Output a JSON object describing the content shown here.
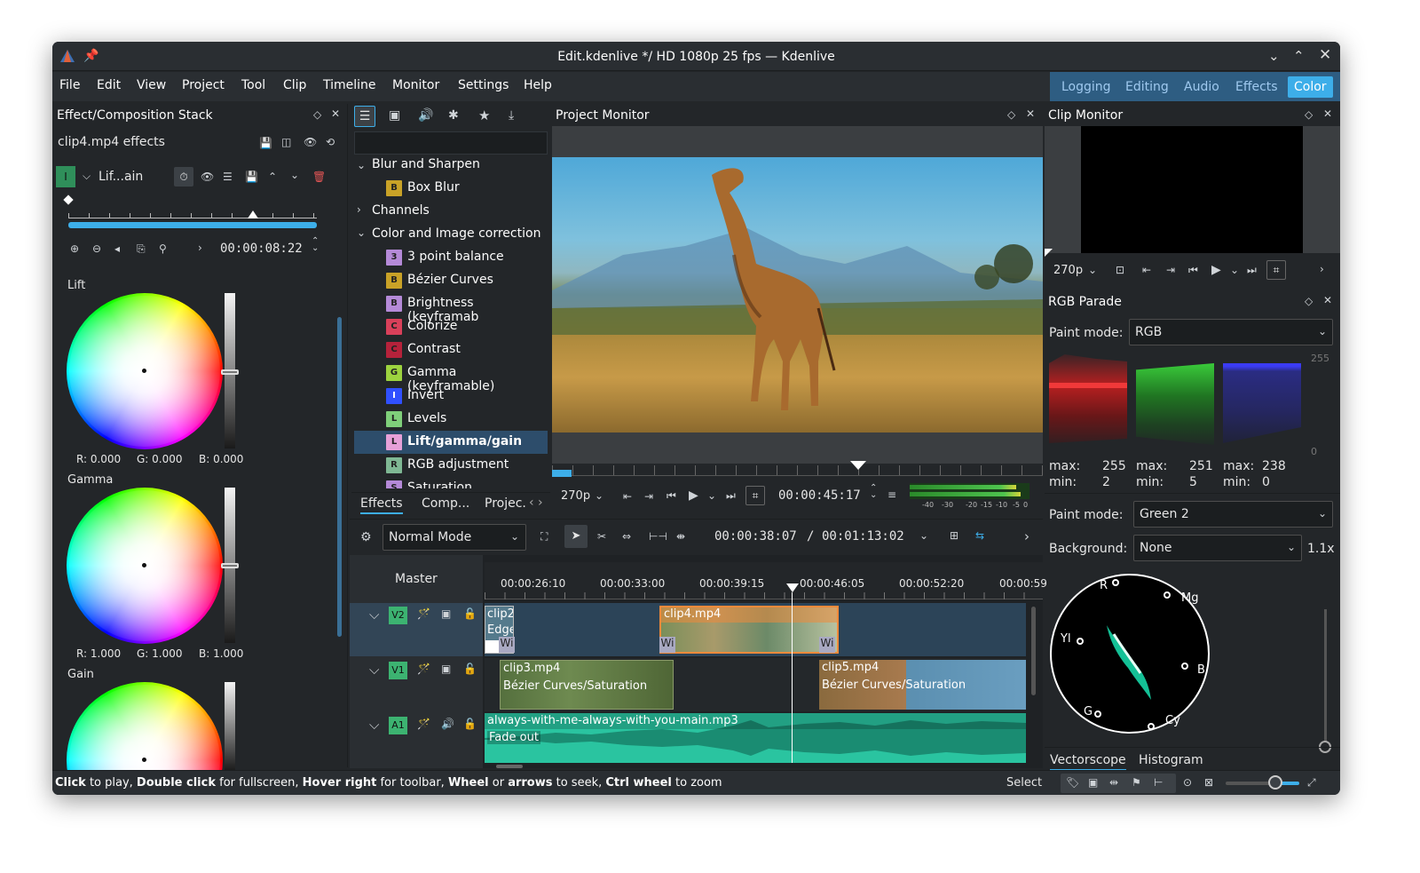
{
  "window": {
    "title": "Edit.kdenlive */ HD 1080p 25 fps — Kdenlive"
  },
  "menu": [
    "File",
    "Edit",
    "View",
    "Project",
    "Tool",
    "Clip",
    "Timeline",
    "Monitor",
    "Settings",
    "Help"
  ],
  "layouts": [
    "Logging",
    "Editing",
    "Audio",
    "Effects",
    "Color"
  ],
  "effect_stack": {
    "title": "Effect/Composition Stack",
    "clip_effects": "clip4.mp4 effects",
    "effect_name": "Lif...ain",
    "badge": "I",
    "timecode": "00:00:08:22",
    "lift": {
      "label": "Lift",
      "r": "R: 0.000",
      "g": "G: 0.000",
      "b": "B: 0.000"
    },
    "gamma": {
      "label": "Gamma",
      "r": "R: 1.000",
      "g": "G: 1.000",
      "b": "B: 1.000"
    },
    "gain": {
      "label": "Gain"
    }
  },
  "effects_list": {
    "categories": [
      "Blur and Sharpen",
      "Channels",
      "Color and Image correction"
    ],
    "items": [
      {
        "badge": "B",
        "label": "Box Blur",
        "color": "#c9a227"
      },
      {
        "badge": "3",
        "label": "3 point balance",
        "color": "#b58ad8"
      },
      {
        "badge": "B",
        "label": "Bézier Curves",
        "color": "#c9a227"
      },
      {
        "badge": "B",
        "label": "Brightness (keyframab",
        "color": "#b58ad8"
      },
      {
        "badge": "C",
        "label": "Colorize",
        "color": "#d9405a"
      },
      {
        "badge": "C",
        "label": "Contrast",
        "color": "#b6223b"
      },
      {
        "badge": "G",
        "label": "Gamma (keyframable)",
        "color": "#9dd33f"
      },
      {
        "badge": "I",
        "label": "Invert",
        "color": "#3050ff"
      },
      {
        "badge": "L",
        "label": "Levels",
        "color": "#7fcf7a"
      },
      {
        "badge": "L",
        "label": "Lift/gamma/gain",
        "color": "#e6a0d8"
      },
      {
        "badge": "R",
        "label": "RGB adjustment",
        "color": "#7fb894"
      },
      {
        "badge": "S",
        "label": "Saturation",
        "color": "#b58ad8"
      }
    ],
    "tabs": [
      "Effects",
      "Comp...",
      "Projec."
    ]
  },
  "project_monitor": {
    "title": "Project Monitor",
    "zoom": "270p",
    "timecode": "00:00:45:17",
    "meter_ticks": [
      "-40",
      "-30",
      "-20",
      "-15",
      "-10",
      "-5",
      "0"
    ]
  },
  "clip_monitor": {
    "title": "Clip Monitor",
    "zoom": "270p"
  },
  "rgb_parade": {
    "title": "RGB Parade",
    "paint_mode_label": "Paint mode:",
    "paint_mode": "RGB",
    "scale_top": "255",
    "scale_bottom": "0",
    "red": {
      "max": "255",
      "min": "2"
    },
    "green": {
      "max": "251",
      "min": "5"
    },
    "blue": {
      "max": "238",
      "min": "0"
    },
    "max_label": "max:",
    "min_label": "min:"
  },
  "vectorscope": {
    "paint_mode_label": "Paint mode:",
    "paint_mode": "Green 2",
    "background_label": "Background:",
    "background": "None",
    "zoom": "1.1x",
    "labels": [
      "R",
      "Mg",
      "Yl",
      "B",
      "G",
      "Cy"
    ],
    "tabs": [
      "Vectorscope",
      "Histogram"
    ]
  },
  "timeline": {
    "mode": "Normal Mode",
    "position": "00:00:38:07",
    "separator": "/",
    "duration": "00:01:13:02",
    "master": "Master",
    "ruler": [
      "00:00:26:10",
      "00:00:33:00",
      "00:00:39:15",
      "00:00:46:05",
      "00:00:52:20",
      "00:00:59"
    ],
    "tracks": [
      {
        "name": "V2"
      },
      {
        "name": "V1"
      },
      {
        "name": "A1"
      }
    ],
    "clips": {
      "clip2": "clip2",
      "clip2_effect": "Edge",
      "wi": "Wi",
      "clip4": "clip4.mp4",
      "clip3": "clip3.mp4",
      "clip3_effect": "Bézier Curves/Saturation",
      "clip5": "clip5.mp4",
      "clip5_effect": "Bézier Curves/Saturation",
      "audio": "always-with-me-always-with-you-main.mp3",
      "audio_effect": "Fade out"
    }
  },
  "status": {
    "hint_parts": [
      "Click",
      " to play, ",
      "Double click",
      " for fullscreen, ",
      "Hover right",
      " for toolbar, ",
      "Wheel",
      " or ",
      "arrows",
      " to seek, ",
      "Ctrl wheel",
      " to zoom"
    ],
    "tool": "Select"
  },
  "colors": {
    "accent": "#3daee9",
    "window_bg": "#232629",
    "titlebar": "#2a2e32",
    "clip_orange": "#f08a3b",
    "audio_teal": "#2ac4a0",
    "track_green": "#3cb371"
  }
}
